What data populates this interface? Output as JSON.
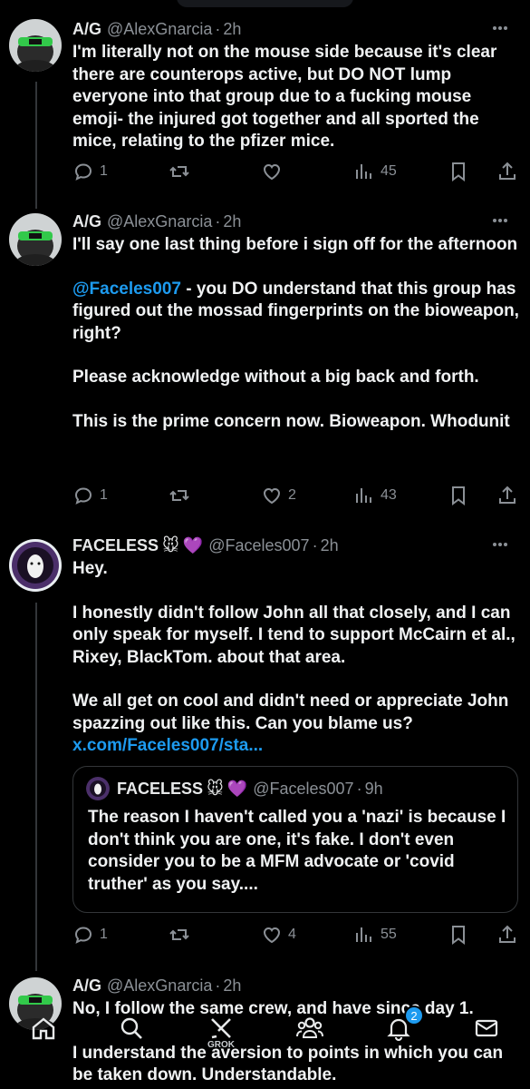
{
  "tweets": [
    {
      "name": "A/G",
      "handle": "@AlexGnarcia",
      "time": "2h",
      "lines": [
        "I'm literally not on the mouse side because it's clear there are counterops active, but DO NOT lump everyone into that group due to a fucking mouse emoji- the injured got together and all sported the mice, relating to the pfizer mice."
      ],
      "replies": "1",
      "retweets": "",
      "likes": "",
      "views": "45"
    },
    {
      "name": "A/G",
      "handle": "@AlexGnarcia",
      "time": "2h",
      "line1": "I'll say one last thing before i sign off for the afternoon",
      "mention": "@Faceles007",
      "line2": " - you DO understand that this group has figured out the mossad fingerprints on the bioweapon, right?",
      "line3": "Please acknowledge without a big back and forth.",
      "line4": "This is the prime concern now. Bioweapon. Whodunit",
      "replies": "1",
      "retweets": "",
      "likes": "2",
      "views": "43"
    },
    {
      "name": "FACELESS",
      "emoji1": "🐭",
      "emoji2": "💜",
      "handle": "@Faceles007",
      "time": "2h",
      "line1": "Hey.",
      "line2": "I honestly didn't follow John all that closely, and I can only speak for myself. I tend to support McCairn et al., Rixey, BlackTom. about that area.",
      "line3": "We all get on cool and didn't need or appreciate John spazzing out like this. Can you blame us?",
      "link": "x.com/Faceles007/sta...",
      "quote": {
        "name": "FACELESS",
        "emoji1": "🐭",
        "emoji2": "💜",
        "handle": "@Faceles007",
        "time": "9h",
        "text": "The reason I haven't called you a 'nazi' is because I don't think you are one, it's fake. I don't even consider you to be a MFM advocate or 'covid truther' as you say...."
      },
      "replies": "1",
      "retweets": "",
      "likes": "4",
      "views": "55"
    },
    {
      "name": "A/G",
      "handle": "@AlexGnarcia",
      "time": "2h",
      "line1": "No, I follow the same crew, and have since day 1.",
      "line2": "I understand the aversion to points in which you can be taken down. Understandable."
    }
  ],
  "dot": "·",
  "nav": {
    "grok_label": "GROK",
    "notifications_badge": "2",
    "icons": [
      "home-icon",
      "search-icon",
      "grok-icon",
      "communities-icon",
      "notifications-icon",
      "messages-icon"
    ]
  },
  "colors": {
    "background": "#000000",
    "accent": "#1d9bf0",
    "text": "#e7e9ea",
    "muted": "#8b9096"
  }
}
